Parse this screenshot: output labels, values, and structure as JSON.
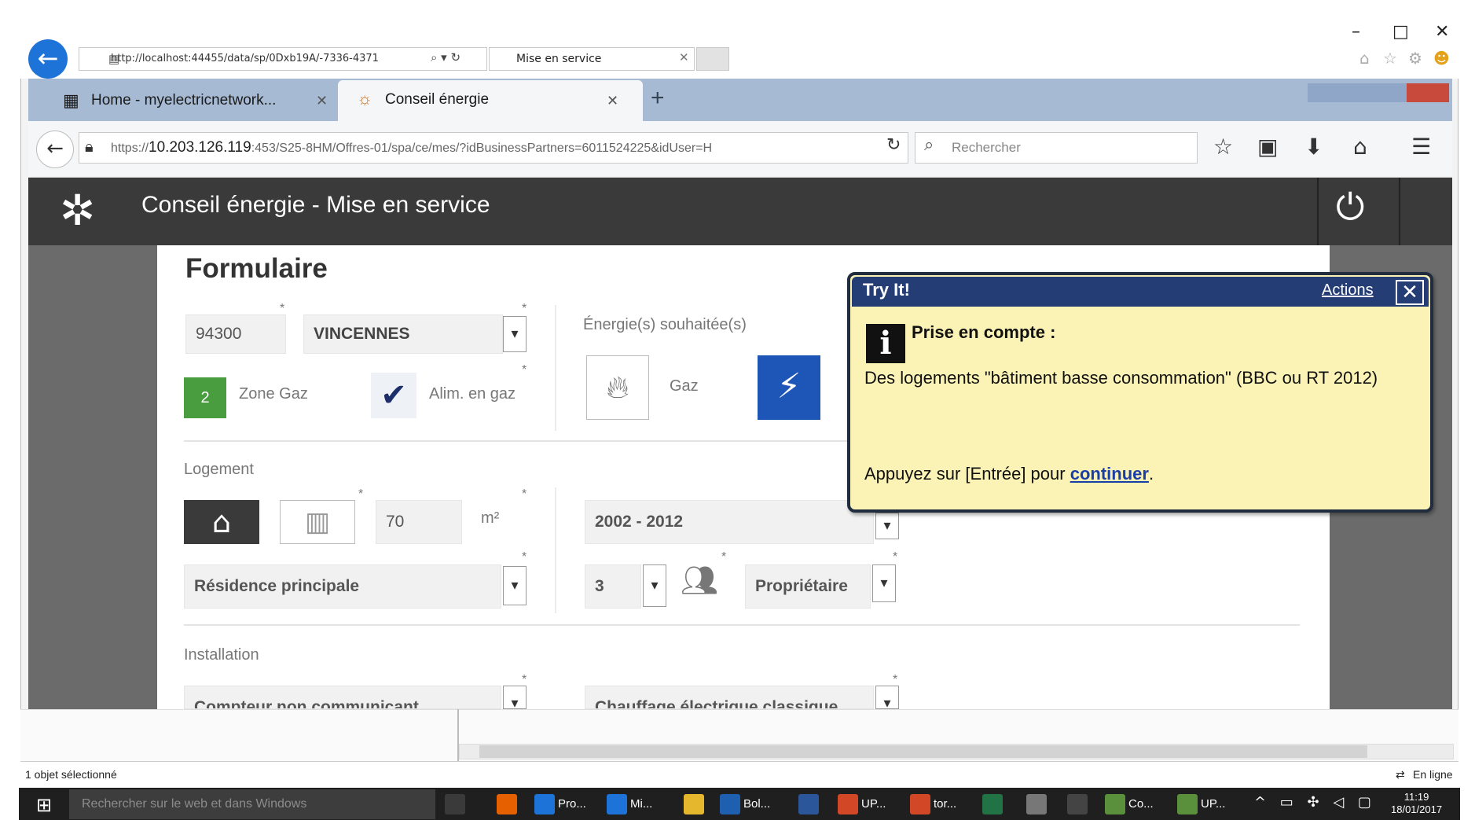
{
  "ie": {
    "address": "http://localhost:44455/data/sp/0Dxb19A/-7336-4371",
    "tab_title": "Mise en service",
    "window_controls": {
      "minimize": "–",
      "maximize": "□",
      "close": "✕"
    }
  },
  "firefox": {
    "tabs": [
      {
        "label": "Home - myelectricnetwork...",
        "icon": "grid-icon"
      },
      {
        "label": "Conseil énergie",
        "icon": "sun-icon"
      }
    ],
    "url_host": "10.203.126.119",
    "url_prefix": "https://",
    "url_rest": ":453/S25-8HM/Offres-01/spa/ce/mes/?idBusinessPartners=6011524225&idUser=H",
    "search_placeholder": "Rechercher"
  },
  "app": {
    "title": "Conseil énergie - Mise en service"
  },
  "form": {
    "section_title": "Formulaire",
    "postal_code": "94300",
    "city": "VINCENNES",
    "zone_badge": "2",
    "zone_label": "Zone Gaz",
    "gas_supply_label": "Alim. en gaz",
    "energy_label": "Énergie(s) souhaitée(s)",
    "gas_option_label": "Gaz",
    "housing_label": "Logement",
    "surface_value": "70",
    "surface_unit": "m²",
    "period": "2002 - 2012",
    "residence": "Résidence principale",
    "occupants": "3",
    "status": "Propriétaire",
    "installation_label": "Installation",
    "meter": "Compteur non communicant",
    "heating": "Chauffage électrique classique"
  },
  "tooltip": {
    "title": "Try It!",
    "actions": "Actions",
    "close": "✕",
    "info_letter": "i",
    "heading": "Prise en compte :",
    "text": "Des logements \"bâtiment basse consommation\" (BBC ou RT 2012)",
    "footer_prefix": "Appuyez sur [Entrée] pour ",
    "footer_link": "continuer",
    "footer_suffix": "."
  },
  "status_bar": {
    "left": "1 objet sélectionné",
    "right": "En ligne"
  },
  "taskbar": {
    "search_placeholder": "Rechercher sur le web et dans Windows",
    "items": [
      {
        "label": "",
        "icon": "task-view-icon",
        "color": "#3a3a3a"
      },
      {
        "label": "",
        "icon": "firefox-icon",
        "color": "#e66000"
      },
      {
        "label": "Pro...",
        "icon": "ie-icon",
        "color": "#1e73d8"
      },
      {
        "label": "Mi...",
        "icon": "ie-icon",
        "color": "#1e73d8"
      },
      {
        "label": "",
        "icon": "explorer-icon",
        "color": "#e5b72c"
      },
      {
        "label": "Bol...",
        "icon": "outlook-icon",
        "color": "#1f5fb0"
      },
      {
        "label": "",
        "icon": "word-icon",
        "color": "#2b579a"
      },
      {
        "label": "UP...",
        "icon": "powerpoint-icon",
        "color": "#d24726"
      },
      {
        "label": "tor...",
        "icon": "powerpoint-icon",
        "color": "#d24726"
      },
      {
        "label": "",
        "icon": "excel-icon",
        "color": "#217346"
      },
      {
        "label": "",
        "icon": "gear-icon",
        "color": "#777777"
      },
      {
        "label": "",
        "icon": "calculator-icon",
        "color": "#444444"
      },
      {
        "label": "Co...",
        "icon": "app-icon",
        "color": "#5a8f3c"
      },
      {
        "label": "UP...",
        "icon": "app-icon",
        "color": "#5a8f3c"
      }
    ],
    "clock_time": "11:19",
    "clock_date": "18/01/2017"
  }
}
